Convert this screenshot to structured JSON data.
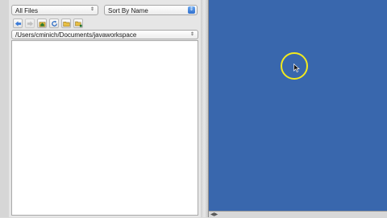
{
  "file_browser": {
    "filter_select": {
      "value": "All Files"
    },
    "sort_select": {
      "value": "Sort By Name"
    },
    "toolbar": {
      "buttons": [
        {
          "icon": "back-arrow-icon",
          "enabled": true
        },
        {
          "icon": "forward-arrow-icon",
          "enabled": false
        },
        {
          "icon": "home-folder-icon",
          "enabled": true
        },
        {
          "icon": "refresh-icon",
          "enabled": true
        },
        {
          "icon": "folder-icon",
          "enabled": true
        },
        {
          "icon": "new-folder-icon",
          "enabled": true
        }
      ]
    },
    "path_select": {
      "value": "/Users/cminich/Documents/javaworkspace"
    }
  },
  "colors": {
    "canvas_background": "#3967ad",
    "cursor_highlight": "#f2ea1e",
    "select_accent": "#2f6fce"
  }
}
